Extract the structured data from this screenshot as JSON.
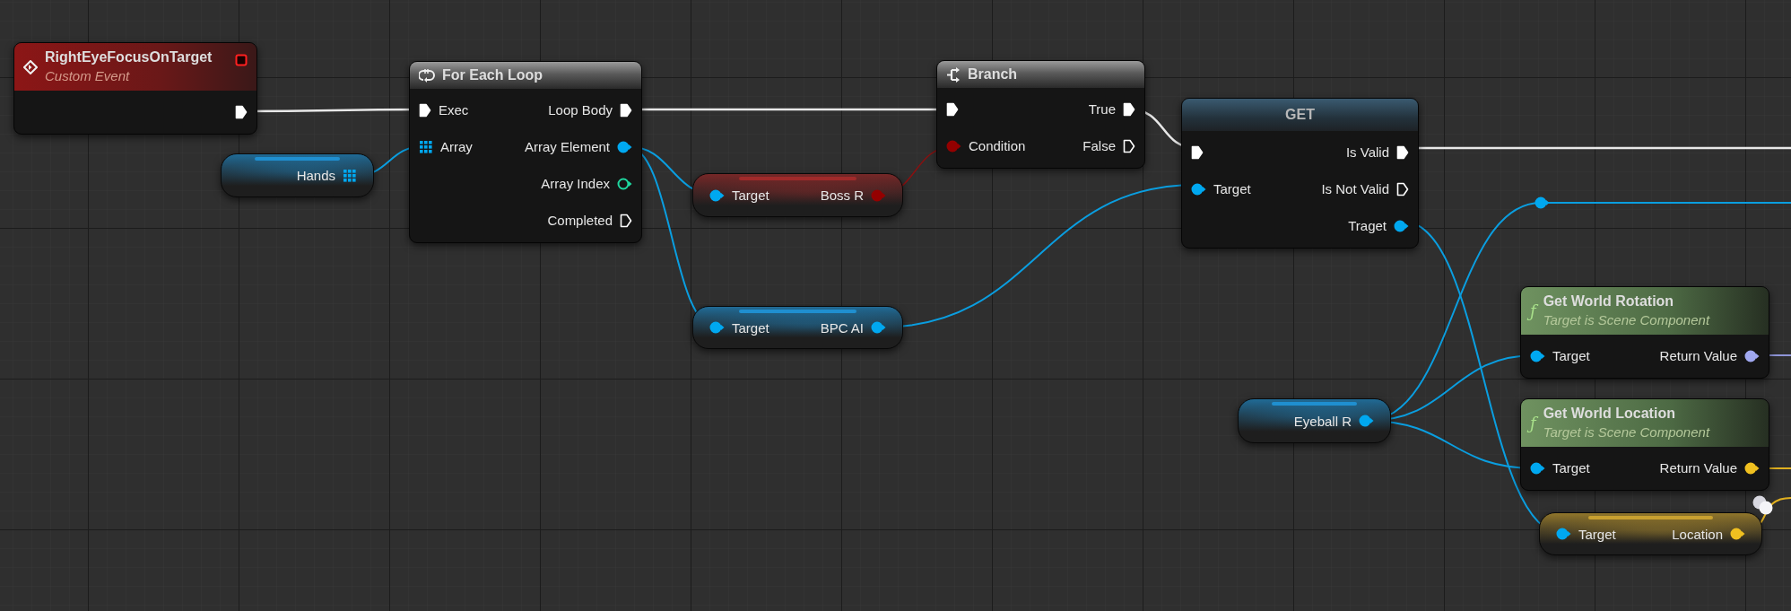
{
  "graph": {
    "nodes": [
      {
        "kind": "event",
        "title": "RightEyeFocusOnTarget",
        "subtitle": "Custom Event",
        "header_pin": {
          "kind": "delegate",
          "color": "#ff2020",
          "connected": false
        },
        "outputs": [
          {
            "kind": "exec",
            "color": "#ffffff",
            "connected": true
          }
        ]
      },
      {
        "kind": "loop",
        "title": "For Each Loop",
        "inputs": [
          {
            "kind": "exec",
            "label": "Exec",
            "color": "#ffffff",
            "connected": true
          },
          {
            "kind": "array",
            "label": "Array",
            "color": "#00a8f0",
            "connected": true
          }
        ],
        "outputs": [
          {
            "kind": "exec",
            "label": "Loop Body",
            "color": "#ffffff",
            "connected": true
          },
          {
            "kind": "data",
            "label": "Array Element",
            "color": "#00a8f0",
            "connected": true
          },
          {
            "kind": "data",
            "label": "Array Index",
            "color": "#1fd8a0",
            "connected": false
          },
          {
            "kind": "exec",
            "label": "Completed",
            "color": "#ffffff",
            "connected": false
          }
        ]
      },
      {
        "kind": "pill",
        "color": "#1f8fd0",
        "outputs": [
          {
            "kind": "array",
            "label": "Hands",
            "color": "#00a8f0",
            "connected": true
          }
        ]
      },
      {
        "kind": "branch",
        "title": "Branch",
        "inputs": [
          {
            "kind": "exec",
            "color": "#ffffff",
            "connected": true
          },
          {
            "kind": "data",
            "label": "Condition",
            "color": "#940000",
            "connected": true
          }
        ],
        "outputs": [
          {
            "kind": "exec",
            "label": "True",
            "color": "#ffffff",
            "connected": true
          },
          {
            "kind": "exec",
            "label": "False",
            "color": "#ffffff",
            "connected": false
          }
        ]
      },
      {
        "kind": "pill",
        "color": "#a02a2a",
        "inputs": [
          {
            "kind": "data",
            "label": "Target",
            "color": "#00a8f0",
            "connected": true
          }
        ],
        "outputs": [
          {
            "kind": "data",
            "label": "Boss R",
            "color": "#940000",
            "connected": true
          }
        ]
      },
      {
        "kind": "pill",
        "color": "#1f8fd0",
        "inputs": [
          {
            "kind": "data",
            "label": "Target",
            "color": "#00a8f0",
            "connected": true
          }
        ],
        "outputs": [
          {
            "kind": "data",
            "label": "BPC AI",
            "color": "#00a8f0",
            "connected": true
          }
        ]
      },
      {
        "kind": "getter",
        "title": "GET",
        "inputs": [
          {
            "kind": "exec",
            "color": "#ffffff",
            "connected": true
          },
          {
            "kind": "data",
            "label": "Target",
            "color": "#00a8f0",
            "connected": true
          }
        ],
        "outputs": [
          {
            "kind": "exec",
            "label": "Is Valid",
            "color": "#ffffff",
            "connected": true
          },
          {
            "kind": "exec",
            "label": "Is Not Valid",
            "color": "#ffffff",
            "connected": false
          },
          {
            "kind": "data",
            "label": "Traget",
            "color": "#00a8f0",
            "connected": true
          }
        ]
      },
      {
        "kind": "reroute",
        "outputs": [
          {
            "kind": "data",
            "color": "#00a8f0",
            "connected": true
          }
        ]
      },
      {
        "kind": "pill",
        "color": "#1f8fd0",
        "outputs": [
          {
            "kind": "data",
            "label": "Eyeball R",
            "color": "#00a8f0",
            "connected": true
          }
        ]
      },
      {
        "kind": "function",
        "icon_glyph": "ƒ",
        "title": "Get World Rotation",
        "subtitle": "Target is Scene Component",
        "inputs": [
          {
            "kind": "data",
            "label": "Target",
            "color": "#00a8f0",
            "connected": true
          }
        ],
        "outputs": [
          {
            "kind": "data",
            "label": "Return Value",
            "color": "#a0a8f0",
            "connected": true
          }
        ]
      },
      {
        "kind": "function",
        "icon_glyph": "ƒ",
        "title": "Get World Location",
        "subtitle": "Target is Scene Component",
        "inputs": [
          {
            "kind": "data",
            "label": "Target",
            "color": "#00a8f0",
            "connected": true
          }
        ],
        "outputs": [
          {
            "kind": "data",
            "label": "Return Value",
            "color": "#f0c020",
            "connected": true
          }
        ]
      },
      {
        "kind": "pill",
        "color": "#c8a030",
        "badge": true,
        "inputs": [
          {
            "kind": "data",
            "label": "Target",
            "color": "#00a8f0",
            "connected": true
          }
        ],
        "outputs": [
          {
            "kind": "data",
            "label": "Location",
            "color": "#f0c020",
            "connected": true
          }
        ]
      }
    ]
  }
}
